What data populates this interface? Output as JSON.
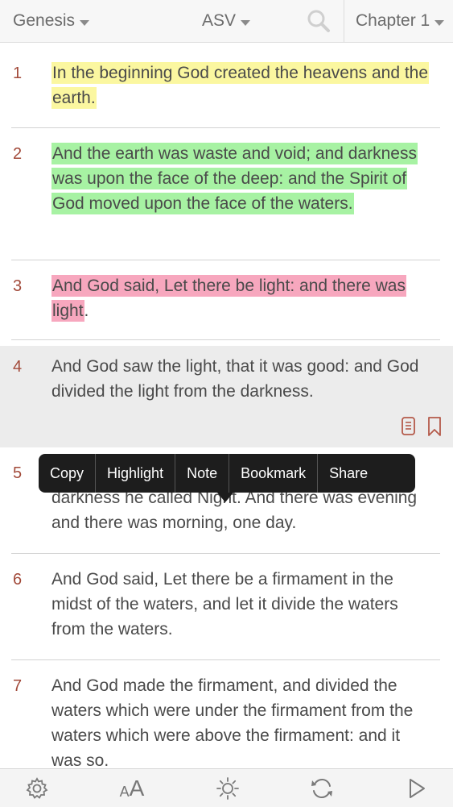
{
  "topbar": {
    "book": "Genesis",
    "version": "ASV",
    "chapter": "Chapter 1",
    "icons": {
      "search": "search-icon",
      "book_caret": "chevron-down-icon"
    }
  },
  "verses": [
    {
      "num": "1",
      "text": "In the beginning God created the heavens and the earth.",
      "highlight": "yellow"
    },
    {
      "num": "2",
      "text": "And the earth was waste and void; and darkness was upon the face of the deep: and the Spirit of God moved upon the face of the waters.",
      "highlight": "green"
    },
    {
      "num": "3",
      "text": "And God said, Let there be light: and there was light",
      "tail": ".",
      "highlight": "pink"
    },
    {
      "num": "4",
      "text": "And God saw the light, that it was good: and God divided the light from the darkness.",
      "selected": true
    },
    {
      "num": "5",
      "text": "darkness he called Night. And there was evening and there was morning, one day."
    },
    {
      "num": "6",
      "text": "And God said, Let there be a firmament in the midst of the waters, and let it divide the waters from the waters."
    },
    {
      "num": "7",
      "text": "And God made the firmament, and divided the waters which were under the firmament from the waters which were above the firmament: and it was so."
    }
  ],
  "context_menu": {
    "items": [
      "Copy",
      "Highlight",
      "Note",
      "Bookmark",
      "Share"
    ]
  },
  "bottombar": {
    "font_small": "A",
    "font_large": "A",
    "icons": [
      "gear-icon",
      "font-size-icon",
      "brightness-icon",
      "sync-icon",
      "play-icon"
    ]
  },
  "colors": {
    "highlight_yellow": "#fbf7a0",
    "highlight_green": "#a7f2a3",
    "highlight_pink": "#f7a7be",
    "verse_number": "#a24a3a"
  }
}
